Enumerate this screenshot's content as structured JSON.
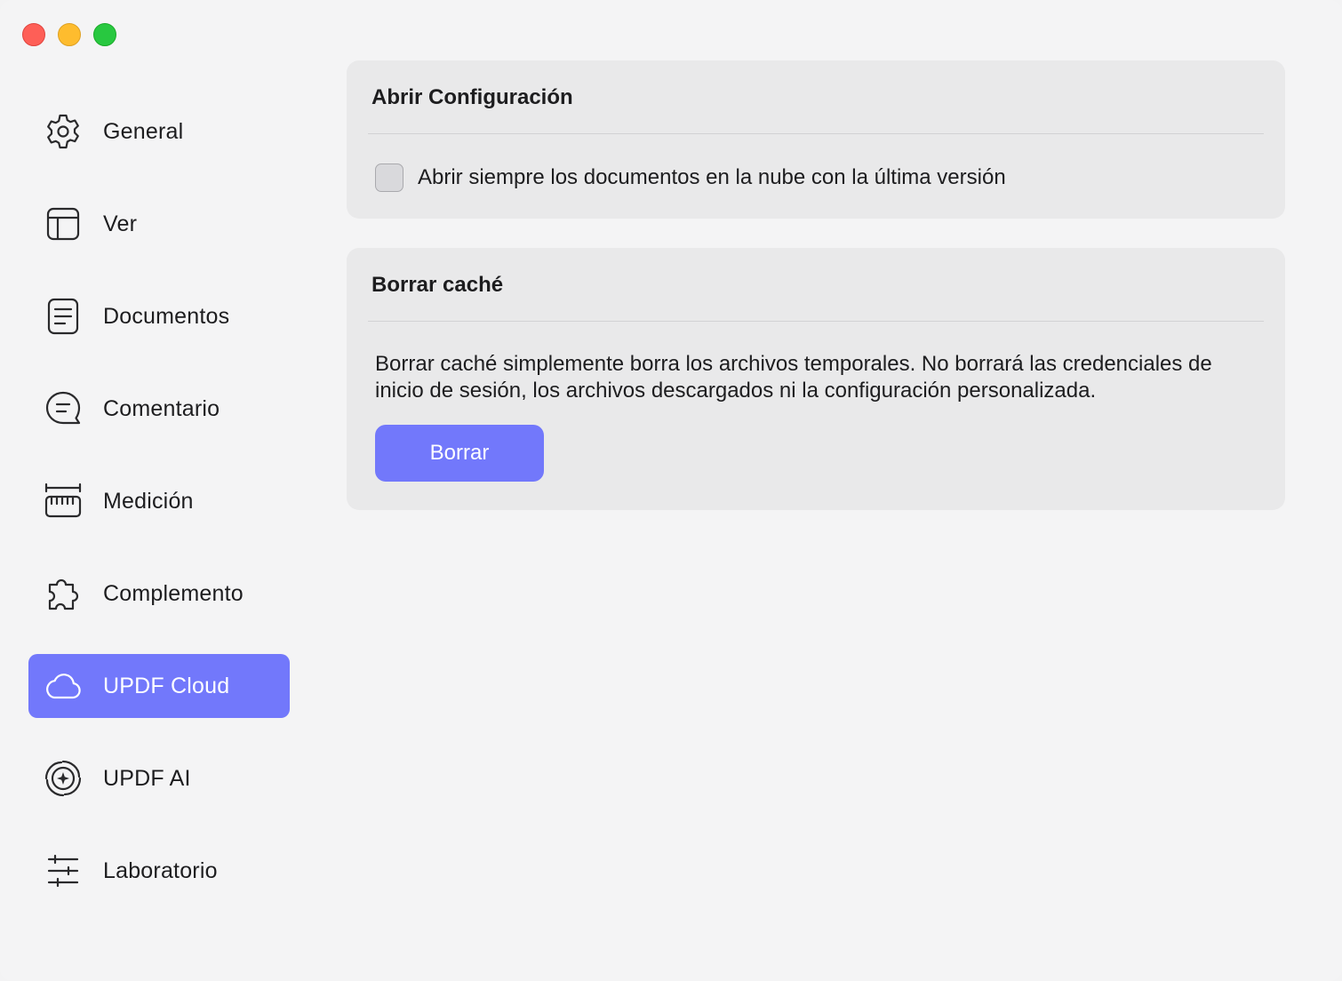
{
  "window": {
    "controls": [
      "close",
      "minimize",
      "zoom"
    ]
  },
  "sidebar": {
    "items": [
      {
        "label": "General",
        "icon": "gear-icon",
        "active": false
      },
      {
        "label": "Ver",
        "icon": "layout-icon",
        "active": false
      },
      {
        "label": "Documentos",
        "icon": "document-icon",
        "active": false
      },
      {
        "label": "Comentario",
        "icon": "comment-icon",
        "active": false
      },
      {
        "label": "Medición",
        "icon": "ruler-icon",
        "active": false
      },
      {
        "label": "Complemento",
        "icon": "puzzle-icon",
        "active": false
      },
      {
        "label": "UPDF Cloud",
        "icon": "cloud-icon",
        "active": true
      },
      {
        "label": "UPDF AI",
        "icon": "ai-sparkle-icon",
        "active": false
      },
      {
        "label": "Laboratorio",
        "icon": "sliders-icon",
        "active": false
      }
    ]
  },
  "open_settings": {
    "title": "Abrir Configuración",
    "checkbox_label": "Abrir siempre los documentos en la nube con la última versión",
    "checked": false
  },
  "clear_cache": {
    "title": "Borrar caché",
    "description": "Borrar caché simplemente borra los archivos temporales. No borrará las credenciales de inicio de sesión, los archivos descargados ni la configuración personalizada.",
    "button_label": "Borrar"
  },
  "colors": {
    "accent": "#7278fb",
    "window_background": "#f4f4f5",
    "card_background": "#e9e9ea"
  }
}
